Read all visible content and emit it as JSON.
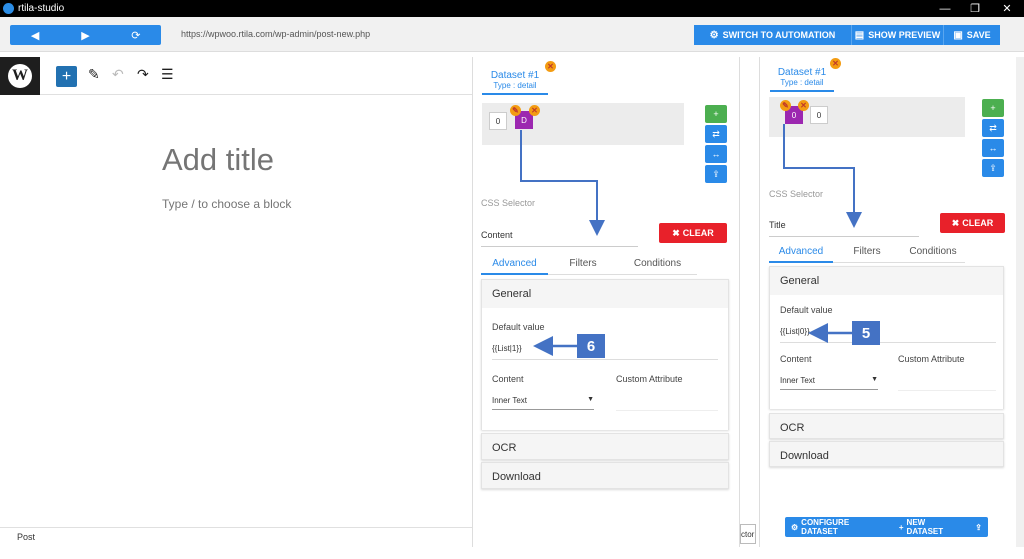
{
  "window": {
    "title": "rtila-studio",
    "controls": [
      "—",
      "❐",
      "✕"
    ]
  },
  "toolbar": {
    "back_icon": "◀",
    "forward_icon": "▶",
    "refresh_icon": "⟳",
    "url": "https://wpwoo.rtila.com/wp-admin/post-new.php",
    "switch_label": "SWITCH TO AUTOMATION",
    "preview_label": "SHOW PREVIEW",
    "save_label": "SAVE"
  },
  "editor": {
    "add_icon": "+",
    "pen_icon": "✎",
    "undo_icon": "↶",
    "redo_icon": "↷",
    "outline_icon": "☰",
    "title_placeholder": "Add title",
    "block_placeholder": "Type / to choose a block",
    "footer": "Post"
  },
  "panel_left": {
    "dataset_name": "Dataset #1",
    "dataset_type": "Type : detail",
    "chips": [
      "0",
      "D"
    ],
    "css_selector_placeholder": "CSS Selector",
    "selector_value": "Content",
    "clear_label": "CLEAR",
    "tabs": [
      "Advanced",
      "Filters",
      "Conditions"
    ],
    "general_header": "General",
    "default_value_label": "Default value",
    "default_value": "{{List|1}}",
    "content_label": "Content",
    "custom_attr_label": "Custom Attribute",
    "content_select": "Inner Text",
    "ocr_header": "OCR",
    "download_header": "Download",
    "callout": "6"
  },
  "panel_right": {
    "dataset_name": "Dataset #1",
    "dataset_type": "Type : detail",
    "chips": [
      "0",
      "0"
    ],
    "css_selector_placeholder": "CSS Selector",
    "selector_value": "Title",
    "clear_label": "CLEAR",
    "tabs": [
      "Advanced",
      "Filters",
      "Conditions"
    ],
    "general_header": "General",
    "default_value_label": "Default value",
    "default_value": "{{List|0}}",
    "content_label": "Content",
    "custom_attr_label": "Custom Attribute",
    "content_select": "Inner Text",
    "ocr_header": "OCR",
    "download_header": "Download",
    "callout": "5",
    "configure_label": "CONFIGURE DATASET",
    "new_dataset_label": "NEW DATASET"
  },
  "fragment_text": "ctor",
  "colors": {
    "accent": "#2a8ae8",
    "danger": "#e8212a",
    "success": "#4caf50",
    "chip": "#9c27b0",
    "callout": "#4472c4"
  }
}
